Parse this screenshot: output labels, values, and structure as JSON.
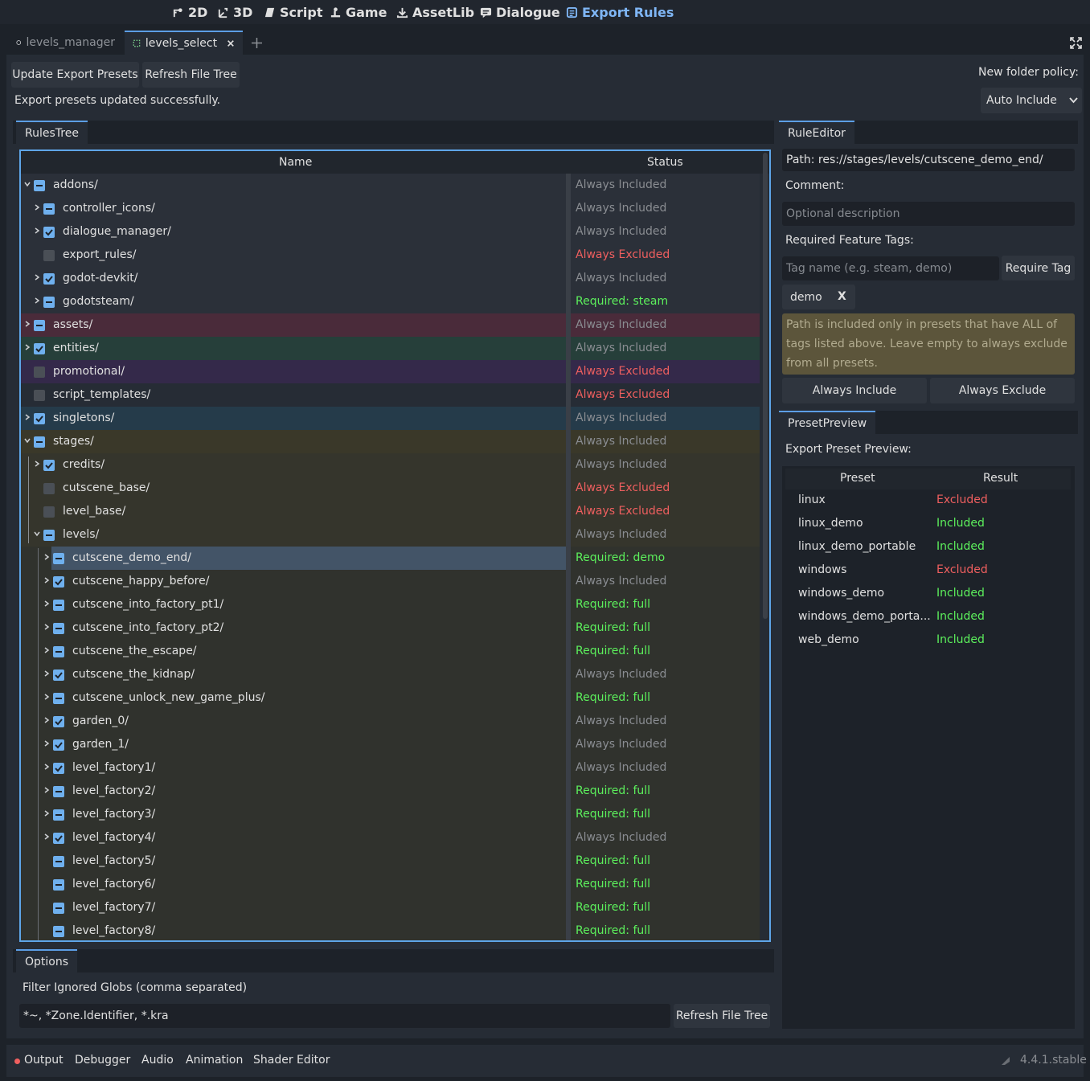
{
  "main_toolbar": {
    "buttons": [
      {
        "label": "2D",
        "icon": "2d-icon"
      },
      {
        "label": "3D",
        "icon": "3d-icon"
      },
      {
        "label": "Script",
        "icon": "script-icon"
      },
      {
        "label": "Game",
        "icon": "game-icon"
      },
      {
        "label": "AssetLib",
        "icon": "assetlib-icon"
      },
      {
        "label": "Dialogue",
        "icon": "dialogue-icon"
      },
      {
        "label": "Export Rules",
        "icon": "export-rules-icon",
        "active": true
      }
    ]
  },
  "scene_tabs": [
    {
      "label": "levels_manager",
      "active": false
    },
    {
      "label": "levels_select",
      "active": true
    }
  ],
  "toolbar": {
    "update_presets_label": "Update Export Presets",
    "refresh_tree_label": "Refresh File Tree",
    "status_message": "Export presets updated successfully.",
    "folder_policy_label": "New folder policy:",
    "folder_policy_value": "Auto Include"
  },
  "rules_tree": {
    "tab_label": "RulesTree",
    "columns": {
      "name": "Name",
      "status": "Status"
    },
    "rows": [
      {
        "name": "addons/",
        "depth": 0,
        "expand": "open",
        "check": "partial",
        "status": "Always Included",
        "kind": "included",
        "bg": "#2b3039"
      },
      {
        "name": "controller_icons/",
        "depth": 1,
        "expand": "closed",
        "check": "partial",
        "status": "Always Included",
        "kind": "included",
        "bg": "#2b3039"
      },
      {
        "name": "dialogue_manager/",
        "depth": 1,
        "expand": "closed",
        "check": "checked",
        "status": "Always Included",
        "kind": "included",
        "bg": "#2b3039"
      },
      {
        "name": "export_rules/",
        "depth": 1,
        "expand": "none",
        "check": "empty",
        "status": "Always Excluded",
        "kind": "excluded",
        "bg": "#2b3039"
      },
      {
        "name": "godot-devkit/",
        "depth": 1,
        "expand": "closed",
        "check": "checked",
        "status": "Always Included",
        "kind": "included",
        "bg": "#2b3039"
      },
      {
        "name": "godotsteam/",
        "depth": 1,
        "expand": "closed",
        "check": "partial",
        "status": "Required: steam",
        "kind": "required",
        "bg": "#2b3039"
      },
      {
        "name": "assets/",
        "depth": 0,
        "expand": "closed",
        "check": "partial",
        "status": "Always Included",
        "kind": "included",
        "bg": "#4a2b3a"
      },
      {
        "name": "entities/",
        "depth": 0,
        "expand": "closed",
        "check": "checked",
        "status": "Always Included",
        "kind": "included",
        "bg": "#263f3a"
      },
      {
        "name": "promotional/",
        "depth": 0,
        "expand": "none",
        "check": "empty",
        "status": "Always Excluded",
        "kind": "excluded",
        "bg": "#34294a"
      },
      {
        "name": "script_templates/",
        "depth": 0,
        "expand": "none",
        "check": "empty",
        "status": "Always Excluded",
        "kind": "excluded",
        "bg": "#262c35"
      },
      {
        "name": "singletons/",
        "depth": 0,
        "expand": "closed",
        "check": "checked",
        "status": "Always Included",
        "kind": "included",
        "bg": "#253b4a"
      },
      {
        "name": "stages/",
        "depth": 0,
        "expand": "open",
        "check": "partial",
        "status": "Always Included",
        "kind": "included",
        "bg": "#3a3829"
      },
      {
        "name": "credits/",
        "depth": 1,
        "expand": "closed",
        "check": "checked",
        "status": "Always Included",
        "kind": "included",
        "bg": "#35352c"
      },
      {
        "name": "cutscene_base/",
        "depth": 1,
        "expand": "none",
        "check": "empty",
        "status": "Always Excluded",
        "kind": "excluded",
        "bg": "#35352c"
      },
      {
        "name": "level_base/",
        "depth": 1,
        "expand": "none",
        "check": "empty",
        "status": "Always Excluded",
        "kind": "excluded",
        "bg": "#35352c"
      },
      {
        "name": "levels/",
        "depth": 1,
        "expand": "open",
        "check": "partial",
        "status": "Always Included",
        "kind": "included",
        "bg": "#35352c"
      },
      {
        "name": "cutscene_demo_end/",
        "depth": 2,
        "expand": "closed",
        "check": "partial",
        "status": "Required: demo",
        "kind": "required",
        "bg": "#30322d",
        "selected": true
      },
      {
        "name": "cutscene_happy_before/",
        "depth": 2,
        "expand": "closed",
        "check": "checked",
        "status": "Always Included",
        "kind": "included",
        "bg": "#30322d"
      },
      {
        "name": "cutscene_into_factory_pt1/",
        "depth": 2,
        "expand": "closed",
        "check": "partial",
        "status": "Required: full",
        "kind": "required",
        "bg": "#30322d"
      },
      {
        "name": "cutscene_into_factory_pt2/",
        "depth": 2,
        "expand": "closed",
        "check": "partial",
        "status": "Required: full",
        "kind": "required",
        "bg": "#30322d"
      },
      {
        "name": "cutscene_the_escape/",
        "depth": 2,
        "expand": "closed",
        "check": "partial",
        "status": "Required: full",
        "kind": "required",
        "bg": "#30322d"
      },
      {
        "name": "cutscene_the_kidnap/",
        "depth": 2,
        "expand": "closed",
        "check": "checked",
        "status": "Always Included",
        "kind": "included",
        "bg": "#30322d"
      },
      {
        "name": "cutscene_unlock_new_game_plus/",
        "depth": 2,
        "expand": "closed",
        "check": "partial",
        "status": "Required: full",
        "kind": "required",
        "bg": "#30322d"
      },
      {
        "name": "garden_0/",
        "depth": 2,
        "expand": "closed",
        "check": "checked",
        "status": "Always Included",
        "kind": "included",
        "bg": "#30322d"
      },
      {
        "name": "garden_1/",
        "depth": 2,
        "expand": "closed",
        "check": "checked",
        "status": "Always Included",
        "kind": "included",
        "bg": "#30322d"
      },
      {
        "name": "level_factory1/",
        "depth": 2,
        "expand": "closed",
        "check": "checked",
        "status": "Always Included",
        "kind": "included",
        "bg": "#30322d"
      },
      {
        "name": "level_factory2/",
        "depth": 2,
        "expand": "closed",
        "check": "partial",
        "status": "Required: full",
        "kind": "required",
        "bg": "#30322d"
      },
      {
        "name": "level_factory3/",
        "depth": 2,
        "expand": "closed",
        "check": "partial",
        "status": "Required: full",
        "kind": "required",
        "bg": "#30322d"
      },
      {
        "name": "level_factory4/",
        "depth": 2,
        "expand": "closed",
        "check": "checked",
        "status": "Always Included",
        "kind": "included",
        "bg": "#30322d"
      },
      {
        "name": "level_factory5/",
        "depth": 2,
        "expand": "none",
        "check": "partial",
        "status": "Required: full",
        "kind": "required",
        "bg": "#30322d"
      },
      {
        "name": "level_factory6/",
        "depth": 2,
        "expand": "none",
        "check": "partial",
        "status": "Required: full",
        "kind": "required",
        "bg": "#30322d"
      },
      {
        "name": "level_factory7/",
        "depth": 2,
        "expand": "none",
        "check": "partial",
        "status": "Required: full",
        "kind": "required",
        "bg": "#30322d"
      },
      {
        "name": "level_factory8/",
        "depth": 2,
        "expand": "none",
        "check": "partial",
        "status": "Required: full",
        "kind": "required",
        "bg": "#30322d"
      }
    ]
  },
  "options": {
    "tab_label": "Options",
    "filter_label": "Filter Ignored Globs (comma separated)",
    "filter_value": "*~, *Zone.Identifier, *.kra",
    "refresh_label": "Refresh File Tree"
  },
  "rule_editor": {
    "tab_label": "RuleEditor",
    "path": "Path: res://stages/levels/cutscene_demo_end/",
    "comment_label": "Comment:",
    "comment_placeholder": "Optional description",
    "tags_label": "Required Feature Tags:",
    "tag_placeholder": "Tag name (e.g. steam, demo)",
    "require_tag_label": "Require Tag",
    "tag_chip": "demo",
    "tag_chip_remove": "X",
    "note": "Path is included only in presets that have ALL of tags listed above. Leave empty to always exclude from all presets.",
    "always_include_label": "Always Include",
    "always_exclude_label": "Always Exclude"
  },
  "preset_preview": {
    "tab_label": "PresetPreview",
    "title": "Export Preset Preview:",
    "columns": {
      "preset": "Preset",
      "result": "Result"
    },
    "rows": [
      {
        "preset": "linux",
        "result": "Excluded",
        "kind": "excluded"
      },
      {
        "preset": "linux_demo",
        "result": "Included",
        "kind": "included"
      },
      {
        "preset": "linux_demo_portable",
        "result": "Included",
        "kind": "included"
      },
      {
        "preset": "windows",
        "result": "Excluded",
        "kind": "excluded"
      },
      {
        "preset": "windows_demo",
        "result": "Included",
        "kind": "included"
      },
      {
        "preset": "windows_demo_porta...",
        "result": "Included",
        "kind": "included"
      },
      {
        "preset": "web_demo",
        "result": "Included",
        "kind": "included"
      }
    ]
  },
  "bottom_dock": {
    "tabs": [
      "Output",
      "Debugger",
      "Audio",
      "Animation",
      "Shader Editor"
    ],
    "version": "4.4.1.stable"
  },
  "colors": {
    "accent": "#5ea5e8",
    "included": "#8a8d92",
    "excluded": "#ef5f5f",
    "required": "#5cf05c",
    "preset_included": "#5cf05c",
    "preset_excluded": "#ef5f5f"
  }
}
